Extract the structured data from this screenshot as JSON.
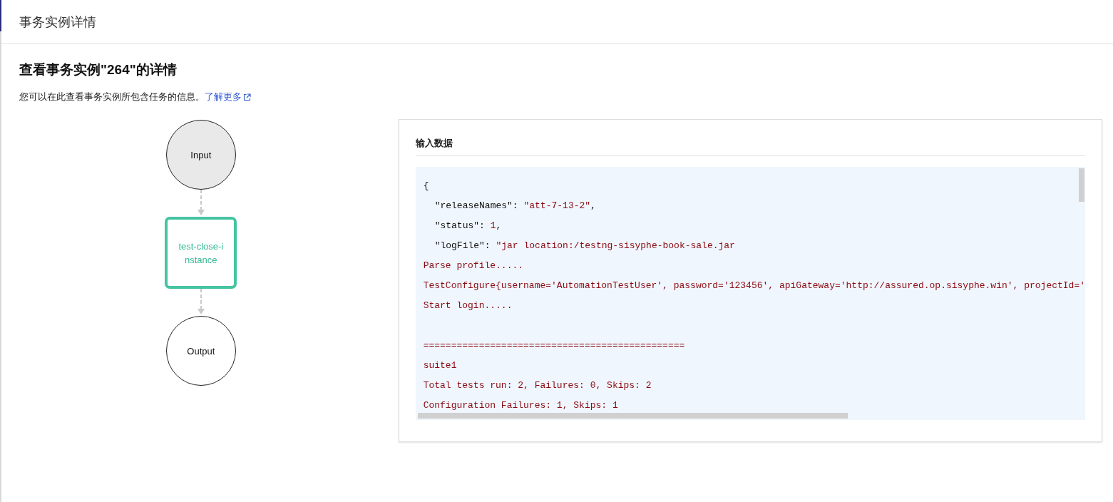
{
  "window": {
    "title": "事务实例详情"
  },
  "page": {
    "heading": "查看事务实例\"264\"的详情",
    "description": "您可以在此查看事务实例所包含任务的信息。",
    "learn_more_link": "了解更多"
  },
  "flow": {
    "nodes": [
      {
        "label": "Input",
        "kind": "input",
        "selected": false
      },
      {
        "label": "test-close-instance",
        "kind": "task",
        "selected": true
      },
      {
        "label": "Output",
        "kind": "output",
        "selected": false
      }
    ]
  },
  "input_panel": {
    "title": "输入数据",
    "lines": [
      {
        "segments": [
          {
            "text": "{",
            "kind": "plain"
          }
        ]
      },
      {
        "indent": true,
        "segments": [
          {
            "text": "\"releaseNames\": ",
            "kind": "plain"
          },
          {
            "text": "\"att-7-13-2\"",
            "kind": "string"
          },
          {
            "text": ",",
            "kind": "plain"
          }
        ]
      },
      {
        "indent": true,
        "segments": [
          {
            "text": "\"status\": ",
            "kind": "plain"
          },
          {
            "text": "1",
            "kind": "string"
          },
          {
            "text": ",",
            "kind": "plain"
          }
        ]
      },
      {
        "indent": true,
        "segments": [
          {
            "text": "\"logFile\": ",
            "kind": "plain"
          },
          {
            "text": "\"jar location:/testng-sisyphe-book-sale.jar",
            "kind": "string"
          }
        ]
      },
      {
        "segments": [
          {
            "text": "Parse profile.....",
            "kind": "string"
          }
        ]
      },
      {
        "segments": [
          {
            "text": "TestConfigure{username='AutomationTestUser', password='123456', apiGateway='http://assured.op.sisyphe.win', projectId='",
            "kind": "string"
          }
        ]
      },
      {
        "segments": [
          {
            "text": "Start login.....",
            "kind": "string"
          }
        ]
      },
      {
        "blank_before": true,
        "segments": [
          {
            "text": "===============================================",
            "kind": "string"
          }
        ]
      },
      {
        "segments": [
          {
            "text": "suite1",
            "kind": "string"
          }
        ]
      },
      {
        "segments": [
          {
            "text": "Total tests run: 2, Failures: 0, Skips: 2",
            "kind": "string"
          }
        ]
      },
      {
        "segments": [
          {
            "text": "Configuration Failures: 1, Skips: 1",
            "kind": "string"
          }
        ]
      }
    ]
  }
}
